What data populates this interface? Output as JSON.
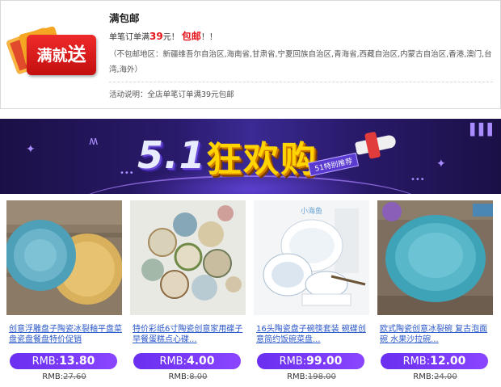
{
  "promo": {
    "title": "满包邮",
    "rule_prefix": "单笔订单满",
    "rule_amount": "39",
    "rule_unit": "元！",
    "rule_free": "包邮",
    "rule_suffix": "！！",
    "exclusions": "（不包邮地区：新疆维吾尔自治区,海南省,甘肃省,宁夏回族自治区,青海省,西藏自治区,内蒙古自治区,香港,澳门,台湾,海外）",
    "note": "活动说明：全店单笔订单满39元包邮",
    "badge_text_small": "满就",
    "badge_text_big": "送"
  },
  "banner": {
    "number": "5.1",
    "title": "狂欢购",
    "tag": "51特别推荐"
  },
  "products": [
    {
      "name": "创意浮雕盘子陶瓷冰裂釉平盘菜盘瓷盘餐盘特价促销",
      "price_label": "RMB:",
      "price": "13.80",
      "old_label": "RMB:",
      "old_price": "27.60",
      "image": "blue-yellow-embossed-plates"
    },
    {
      "name": "特价彩纸6寸陶瓷创意家用碟子早餐蛋糕点心碟...",
      "price_label": "RMB:",
      "price": "4.00",
      "old_label": "RMB:",
      "old_price": "8.00",
      "image": "painted-dessert-plates"
    },
    {
      "name": "16头陶瓷盘子碗筷套装 碗碟创意简约饭碗菜盘...",
      "price_label": "RMB:",
      "price": "99.00",
      "old_label": "RMB:",
      "old_price": "198.00",
      "image": "blue-white-tableware-set"
    },
    {
      "name": "欧式陶瓷创意冰裂碗 复古泡面碗 水果沙拉碗...",
      "price_label": "RMB:",
      "price": "12.00",
      "old_label": "RMB:",
      "old_price": "24.00",
      "image": "turquoise-crackle-bowl"
    }
  ],
  "colors": {
    "accent_red": "#e5141b",
    "price_pill": "#7a3af8",
    "link_blue": "#2b58c8",
    "banner_bg": "#2a1a6b",
    "banner_yellow": "#ffd400"
  }
}
